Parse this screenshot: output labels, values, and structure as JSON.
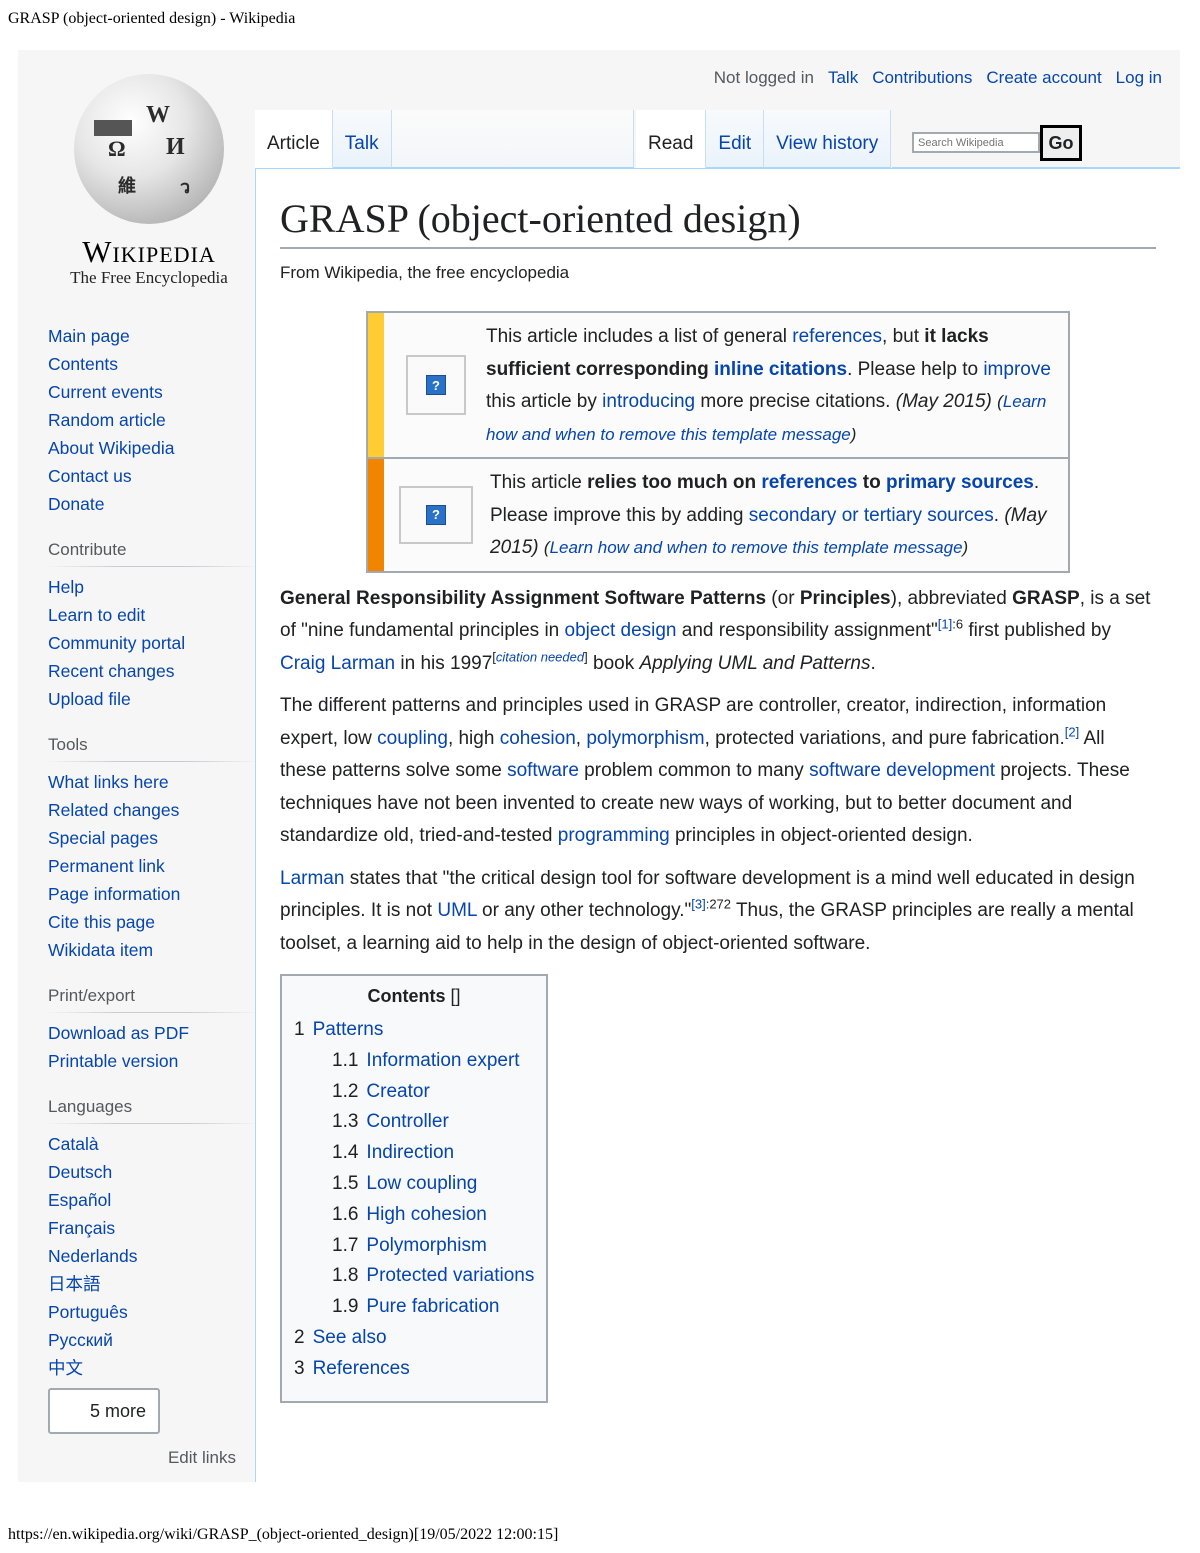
{
  "print_header": "GRASP (object-oriented design) - Wikipedia",
  "print_footer": "https://en.wikipedia.org/wiki/GRASP_(object-oriented_design)[19/05/2022 12:00:15]",
  "logo": {
    "wordmark": "Wikipedia",
    "tagline": "The Free Encyclopedia",
    "glyphs": [
      "W",
      "Ω",
      "И",
      "維",
      "ว"
    ]
  },
  "personal_tools": {
    "status": "Not logged in",
    "links": [
      "Talk",
      "Contributions",
      "Create account",
      "Log in"
    ]
  },
  "tabs": {
    "left": [
      {
        "label": "Article",
        "selected": true
      },
      {
        "label": "Talk",
        "selected": false
      }
    ],
    "right": [
      {
        "label": "Read",
        "selected": true
      },
      {
        "label": "Edit",
        "selected": false
      },
      {
        "label": "View history",
        "selected": false
      }
    ]
  },
  "search": {
    "placeholder": "Search Wikipedia",
    "go_label": "Go"
  },
  "sidebar": {
    "navigation": [
      "Main page",
      "Contents",
      "Current events",
      "Random article",
      "About Wikipedia",
      "Contact us",
      "Donate"
    ],
    "contribute": {
      "heading": "Contribute",
      "items": [
        "Help",
        "Learn to edit",
        "Community portal",
        "Recent changes",
        "Upload file"
      ]
    },
    "tools": {
      "heading": "Tools",
      "items": [
        "What links here",
        "Related changes",
        "Special pages",
        "Permanent link",
        "Page information",
        "Cite this page",
        "Wikidata item"
      ]
    },
    "print": {
      "heading": "Print/export",
      "items": [
        "Download as PDF",
        "Printable version"
      ]
    },
    "languages": {
      "heading": "Languages",
      "items": [
        "Català",
        "Deutsch",
        "Español",
        "Français",
        "Nederlands",
        "日本語",
        "Português",
        "Русский",
        "中文"
      ],
      "more_label": "5 more",
      "edit_links": "Edit links"
    }
  },
  "article": {
    "title": "GRASP (object-oriented design)",
    "subtitle": "From Wikipedia, the free encyclopedia",
    "notices": [
      {
        "stripe_color": "#fc3",
        "t1": "This article includes a list of general ",
        "l1": "references",
        "t2": ", but ",
        "b1": "it lacks sufficient corresponding ",
        "bl1": "inline citations",
        "t3": ". Please help to ",
        "l2": "improve",
        "t4": " this article by ",
        "l3": "introducing",
        "t5": " more precise citations. ",
        "date": "(May 2015)",
        "learn": "Learn how and when to remove this template message"
      },
      {
        "stripe_color": "#f28500",
        "t1": "This article ",
        "b1": "relies too much on ",
        "bl1": "references",
        "b2": " to ",
        "bl2": "primary sources",
        "t2": ". Please improve this by adding ",
        "l1": "secondary or tertiary sources",
        "t3": ". ",
        "date": "(May 2015)",
        "learn": "Learn how and when to remove this template message"
      }
    ],
    "p1": {
      "b1": "General Responsibility Assignment Software Patterns",
      "t1": " (or ",
      "b2": "Principles",
      "t2": "), abbreviated ",
      "b3": "GRASP",
      "t3": ", is a set of \"nine fundamental principles in ",
      "l1": "object design",
      "t4": " and responsibility assignment\"",
      "ref1": "[1]",
      "ref1_page": ":6",
      "t5": " first published by ",
      "l2": "Craig Larman",
      "t6": " in his 1997",
      "cn": "citation needed",
      "t7": " book ",
      "i1": "Applying UML and Patterns",
      "t8": "."
    },
    "p2": {
      "t1": "The different patterns and principles used in GRASP are controller, creator, indirection, information expert, low ",
      "l1": "coupling",
      "t2": ", high ",
      "l2": "cohesion",
      "t3": ", ",
      "l3": "polymorphism",
      "t4": ", protected variations, and pure fabrication.",
      "ref": "[2]",
      "t5": " All these patterns solve some ",
      "l4": "software",
      "t6": " problem common to many ",
      "l5": "software development",
      "t7": " projects. These techniques have not been invented to create new ways of working, but to better document and standardize old, tried-and-tested ",
      "l6": "programming",
      "t8": " principles in object-oriented design."
    },
    "p3": {
      "l1": "Larman",
      "t1": " states that \"the critical design tool for software development is a mind well educated in design principles. It is not ",
      "l2": "UML",
      "t2": " or any other technology.\"",
      "ref": "[3]",
      "ref_page": ":272",
      "t3": " Thus, the GRASP principles are really a mental toolset, a learning aid to help in the design of object-oriented software."
    },
    "toc": {
      "title": "Contents",
      "toggle": "[]",
      "items": [
        {
          "num": "1",
          "label": "Patterns",
          "level": 1
        },
        {
          "num": "1.1",
          "label": "Information expert",
          "level": 2
        },
        {
          "num": "1.2",
          "label": "Creator",
          "level": 2
        },
        {
          "num": "1.3",
          "label": "Controller",
          "level": 2
        },
        {
          "num": "1.4",
          "label": "Indirection",
          "level": 2
        },
        {
          "num": "1.5",
          "label": "Low coupling",
          "level": 2
        },
        {
          "num": "1.6",
          "label": "High cohesion",
          "level": 2
        },
        {
          "num": "1.7",
          "label": "Polymorphism",
          "level": 2
        },
        {
          "num": "1.8",
          "label": "Protected variations",
          "level": 2
        },
        {
          "num": "1.9",
          "label": "Pure fabrication",
          "level": 2
        },
        {
          "num": "2",
          "label": "See also",
          "level": 1
        },
        {
          "num": "3",
          "label": "References",
          "level": 1
        }
      ]
    }
  },
  "colors": {
    "link": "#0645ad",
    "text": "#202122",
    "muted": "#54595d",
    "notice_yellow": "#fc3",
    "notice_orange": "#f28500"
  }
}
